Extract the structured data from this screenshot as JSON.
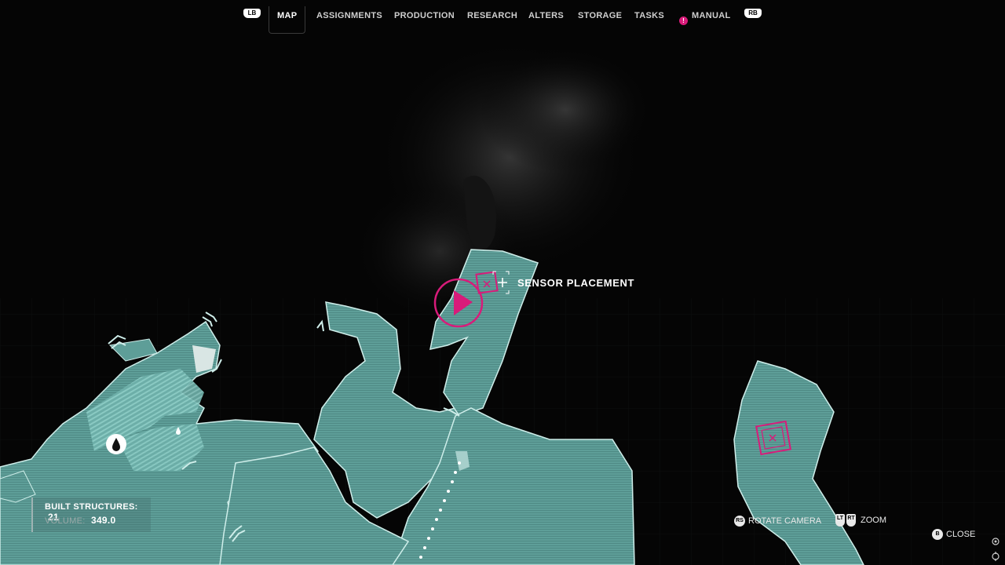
{
  "nav": {
    "lb": "LB",
    "rb": "RB",
    "tabs": [
      "MAP",
      "ASSIGNMENTS",
      "PRODUCTION",
      "RESEARCH",
      "ALTERS",
      "STORAGE",
      "TASKS",
      "MANUAL"
    ],
    "active_tab": "MAP",
    "manual_alert": "!"
  },
  "map": {
    "sensor_label": "SENSOR PLACEMENT",
    "colors": {
      "land": "#5e9e98",
      "land_edge": "#cfeeea",
      "accent": "#d81b7a",
      "background": "#050505"
    },
    "icons": [
      "player-marker-icon",
      "sensor-marker-icon",
      "water-drop-icon",
      "chevron-icon",
      "crosshair-plus-icon"
    ]
  },
  "stats": {
    "built_structures_label": "BUILT STRUCTURES:",
    "built_structures_value": "21",
    "volume_label": "VOLUME:",
    "volume_value": "349.0"
  },
  "hints": {
    "rotate_glyph": "RS",
    "rotate_label": "ROTATE CAMERA",
    "zoom_lt": "LT",
    "zoom_rt": "RT",
    "zoom_label": "ZOOM",
    "close_glyph": "B",
    "close_label": "CLOSE"
  }
}
